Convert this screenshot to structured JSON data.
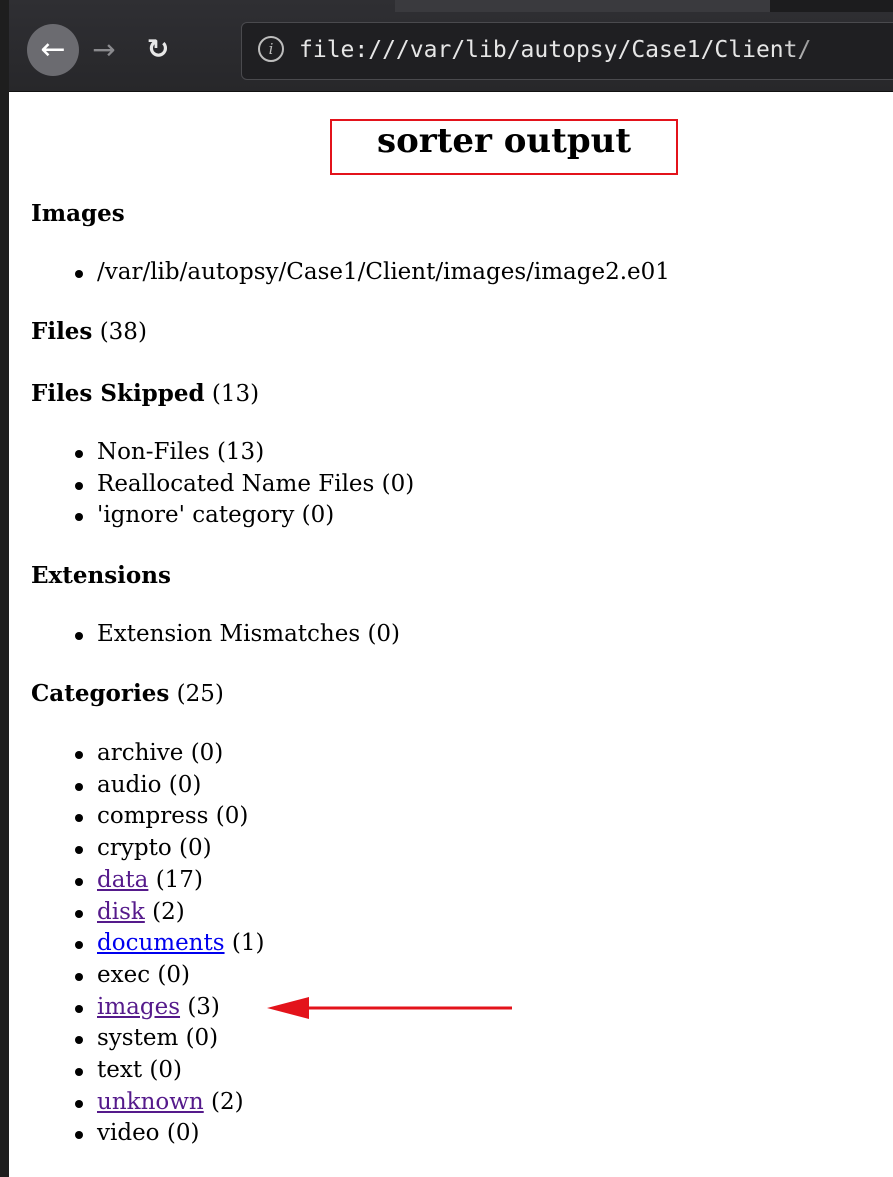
{
  "browser": {
    "back_icon": "arrow-left-icon",
    "forward_icon": "arrow-right-icon",
    "reload_icon": "reload-icon",
    "info_icon": "info-icon",
    "url": "file:///var/lib/autopsy/Case1/Client/"
  },
  "page": {
    "title": "sorter output",
    "images_heading": "Images",
    "images_items": [
      "/var/lib/autopsy/Case1/Client/images/image2.e01"
    ],
    "files_heading": "Files",
    "files_count": "(38)",
    "skipped_heading": "Files Skipped",
    "skipped_count": "(13)",
    "skipped_items": [
      "Non-Files (13)",
      "Reallocated Name Files (0)",
      "'ignore' category (0)"
    ],
    "extensions_heading": "Extensions",
    "extensions_items": [
      "Extension Mismatches (0)"
    ],
    "categories_heading": "Categories",
    "categories_count": "(25)",
    "categories": [
      {
        "name": "archive",
        "count": "(0)",
        "link": false
      },
      {
        "name": "audio",
        "count": "(0)",
        "link": false
      },
      {
        "name": "compress",
        "count": "(0)",
        "link": false
      },
      {
        "name": "crypto",
        "count": "(0)",
        "link": false
      },
      {
        "name": "data",
        "count": "(17)",
        "link": true,
        "visited": true
      },
      {
        "name": "disk",
        "count": "(2)",
        "link": true,
        "visited": true
      },
      {
        "name": "documents",
        "count": "(1)",
        "link": true,
        "visited": false
      },
      {
        "name": "exec",
        "count": "(0)",
        "link": false
      },
      {
        "name": "images",
        "count": "(3)",
        "link": true,
        "visited": true
      },
      {
        "name": "system",
        "count": "(0)",
        "link": false
      },
      {
        "name": "text",
        "count": "(0)",
        "link": false
      },
      {
        "name": "unknown",
        "count": "(2)",
        "link": true,
        "visited": true
      },
      {
        "name": "video",
        "count": "(0)",
        "link": false
      }
    ]
  },
  "annotations": {
    "title_box_color": "#e3131b",
    "arrow_color": "#e3131b"
  }
}
